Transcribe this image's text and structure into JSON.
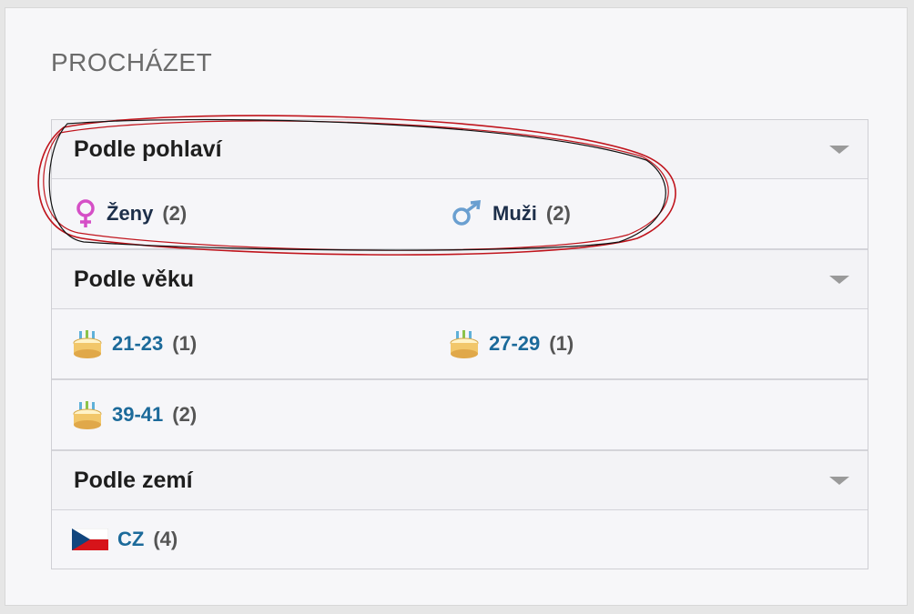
{
  "panel": {
    "title": "PROCHÁZET"
  },
  "sections": [
    {
      "heading": "Podle pohlaví",
      "items": [
        {
          "label": "Ženy",
          "count": "(2)",
          "icon": "female-symbol-icon"
        },
        {
          "label": "Muži",
          "count": "(2)",
          "icon": "male-symbol-icon"
        }
      ]
    },
    {
      "heading": "Podle věku",
      "items": [
        {
          "label": "21-23",
          "count": "(1)",
          "icon": "birthday-cake-icon"
        },
        {
          "label": "27-29",
          "count": "(1)",
          "icon": "birthday-cake-icon"
        },
        {
          "label": "39-41",
          "count": "(2)",
          "icon": "birthday-cake-icon"
        }
      ]
    },
    {
      "heading": "Podle zemí",
      "items": [
        {
          "label": "CZ",
          "count": "(4)",
          "icon": "czech-flag-icon"
        }
      ]
    }
  ],
  "colors": {
    "link": "#1c6a9a",
    "heading": "#1e1e1e",
    "annotation_red": "#c0141c",
    "annotation_black": "#111111"
  }
}
